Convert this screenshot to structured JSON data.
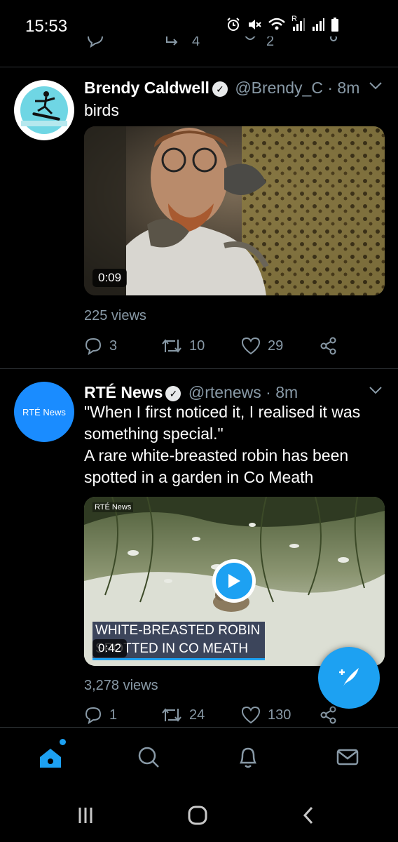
{
  "status_bar": {
    "time": "15:53",
    "icons": [
      "alarm-icon",
      "mute-icon",
      "wifi-icon",
      "signal-icon",
      "signal-icon",
      "battery-icon"
    ],
    "roaming_label": "R"
  },
  "previous_tweet": {
    "retweets": "4",
    "likes": "2"
  },
  "tweets": [
    {
      "author_name": "Brendy Caldwell",
      "handle": "@Brendy_C",
      "separator": "·",
      "time_ago": "8m",
      "verified": true,
      "text": "birds",
      "media": {
        "type": "video",
        "duration": "0:09"
      },
      "views": "225 views",
      "replies": "3",
      "retweets": "10",
      "likes": "29"
    },
    {
      "author_name": "RTÉ News",
      "handle": "@rtenews",
      "separator": "·",
      "time_ago": "8m",
      "verified": true,
      "avatar_text": "RTÉ News",
      "text_lines": [
        "\"When I first noticed it, I realised it was something special.\"",
        "A rare white-breasted robin has been spotted in a garden in Co Meath"
      ],
      "media": {
        "type": "video",
        "duration": "0:42",
        "watermark": "RTÉ News",
        "caption_line1": "WHITE-BREASTED ROBIN",
        "caption_line2": "SPOTTED IN CO MEATH"
      },
      "views": "3,278 views",
      "replies": "1",
      "retweets": "24",
      "likes": "130"
    }
  ],
  "fab": {
    "icon": "compose-tweet-icon"
  },
  "bottom_nav": {
    "items": [
      "home-icon",
      "search-icon",
      "notifications-icon",
      "messages-icon"
    ],
    "active": "home",
    "accent_color": "#1da1f2"
  },
  "system_nav": [
    "recents-icon",
    "home-circle-icon",
    "back-icon"
  ],
  "colors": {
    "background": "#000000",
    "text": "#ffffff",
    "muted": "#8899a6",
    "accent": "#1da1f2",
    "divider": "#2f3336"
  }
}
